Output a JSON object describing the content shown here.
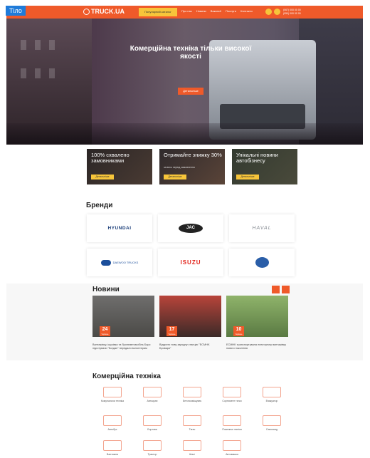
{
  "tag": "Тіло",
  "header": {
    "logo": "TRUCK.UA",
    "pill": "Популярний каталог",
    "nav": [
      "Про нас",
      "Новини",
      "Вакансії",
      "Послуги",
      "Контакти"
    ],
    "phones": [
      "(067) 000 00 00",
      "(050) 000 00 00"
    ]
  },
  "hero": {
    "title": "Комерційна техніка тільки високої якості",
    "button": "Детальніше"
  },
  "promos": [
    {
      "title": "100% схвалено замовниками",
      "sub": "",
      "button": "Детальніше"
    },
    {
      "title": "Отримайте знижку 30%",
      "sub": "за весь період замовлення",
      "button": "Детальніше"
    },
    {
      "title": "Унікальні новини автобізнесу",
      "sub": "",
      "button": "Детальніше"
    }
  ],
  "brands": {
    "title": "Бренди",
    "hyundai": "HYUNDAI",
    "jac": "JAC",
    "haval": "HAVAL",
    "daewoo": "DAEWOO TRUCKS",
    "isuzu": "ISUZU"
  },
  "news": {
    "title": "Новини",
    "items": [
      {
        "day": "24",
        "month": "Червень",
        "text": "Вантажівку, ішузівка та бронеавтомобіль Барс підготували \"Богдан\" передали волонтерам"
      },
      {
        "day": "17",
        "month": "Червень",
        "text": "Відкрито нову зарядну станцію \"ECMHK Бровари\""
      },
      {
        "day": "10",
        "month": "Червень",
        "text": "ECMHK транспортувала електричну вантажівку нового покоління"
      }
    ]
  },
  "commercial": {
    "title": "Комерційна техніка",
    "items": [
      "Комунальна техніка",
      "Автокран",
      "Бетонозмішувач",
      "Сортимент тягач",
      "Евакуатор",
      "Автобус",
      "Бортова",
      "Тягач",
      "Пожежна техніка",
      "Самоскид",
      "Вантажна",
      "Трактор",
      "Шасі",
      "Автовишка"
    ]
  },
  "colors": {
    "accent": "#ef5a2a",
    "yellow": "#f7c53a"
  }
}
